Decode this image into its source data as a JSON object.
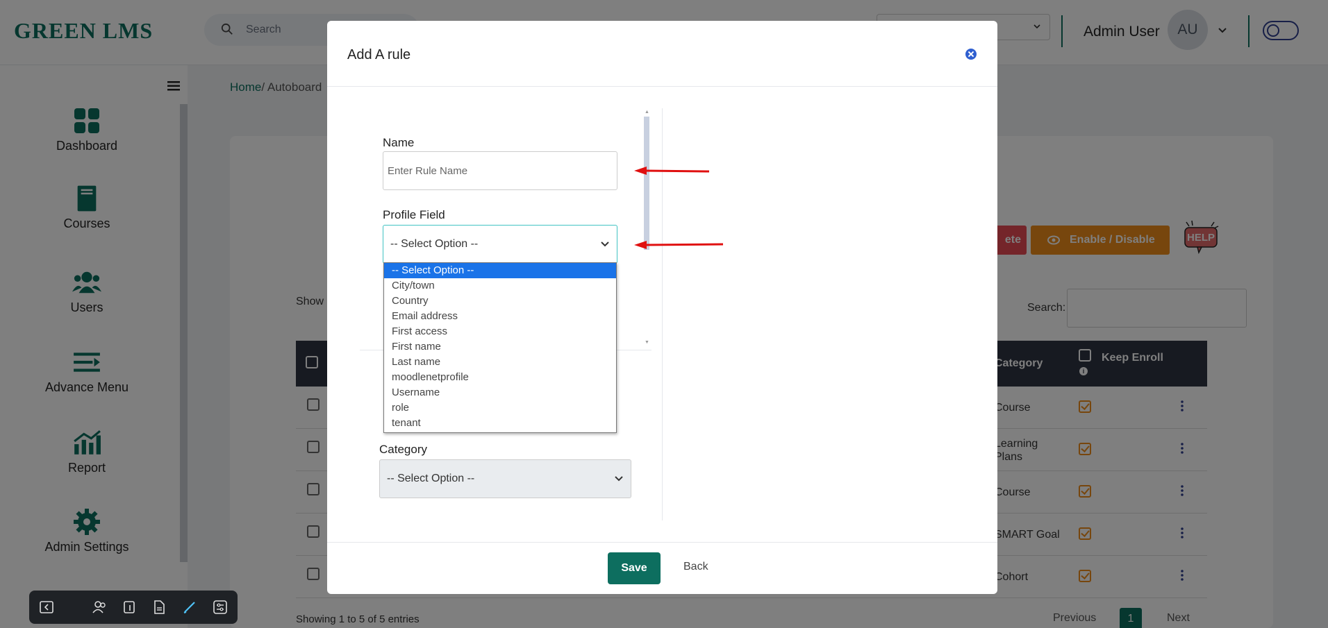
{
  "header": {
    "logo_text": "GREEN LMS",
    "search_placeholder": "Search",
    "admin_name": "Admin User",
    "avatar_initials": "AU"
  },
  "sidebar": {
    "items": [
      {
        "label": "Dashboard",
        "icon": "dashboard-icon"
      },
      {
        "label": "Courses",
        "icon": "book-icon"
      },
      {
        "label": "Users",
        "icon": "users-icon"
      },
      {
        "label": "Advance Menu",
        "icon": "menu-arrow-icon"
      },
      {
        "label": "Report",
        "icon": "chart-icon"
      },
      {
        "label": "Admin Settings",
        "icon": "gear-icon"
      }
    ]
  },
  "breadcrumb": {
    "home": "Home",
    "separator": "/",
    "current": "Autoboard"
  },
  "page": {
    "delete_label": "ete",
    "enable_disable_label": "Enable / Disable",
    "help_label": "HELP",
    "show_label": "Show",
    "search_label": "Search:",
    "table": {
      "headers": {
        "category": "Category",
        "keep_enroll": "Keep Enroll"
      },
      "rows": [
        {
          "category": "Course"
        },
        {
          "category": "Learning Plans"
        },
        {
          "category": "Course"
        },
        {
          "category": "SMART Goal"
        },
        {
          "category": "Cohort"
        }
      ]
    },
    "showing_text": "Showing 1 to 5 of 5 entries",
    "pagination": {
      "previous": "Previous",
      "current": "1",
      "next": "Next"
    }
  },
  "modal": {
    "title": "Add A rule",
    "name_label": "Name",
    "name_placeholder": "Enter Rule Name",
    "profile_field_label": "Profile Field",
    "profile_field_value": "-- Select Option --",
    "profile_field_options": [
      "-- Select Option --",
      "City/town",
      "Country",
      "Email address",
      "First access",
      "First name",
      "Last name",
      "moodlenetprofile",
      "Username",
      "role",
      "tenant"
    ],
    "category_label": "Category",
    "category_value": "-- Select Option --",
    "save_label": "Save",
    "back_label": "Back"
  },
  "colors": {
    "brand": "#0d6e5f",
    "danger": "#e94a55",
    "warning": "#ee8d1a",
    "annotation_arrow": "#e01010",
    "selected_option": "#1a73e8"
  }
}
